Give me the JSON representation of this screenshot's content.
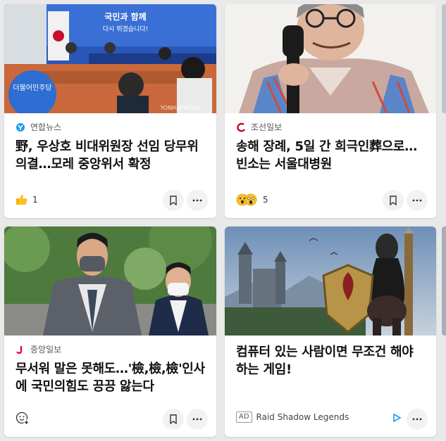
{
  "cards": [
    {
      "source": "연합뉴스",
      "source_icon": "yonhap-logo-icon",
      "headline": "野, 우상호 비대위원장 선임 당무위 의결…모레 중앙위서 확정",
      "reaction_icon": "thumbs-up-icon",
      "reaction_count": "1",
      "image_sign_text": "국민과 함께",
      "image_sign_sub": "다시 뛰겠습니다!",
      "image_logo_text": "더불어민주당",
      "image_watermark": "YONHAPNEWS"
    },
    {
      "source": "조선일보",
      "source_icon": "chosun-logo-icon",
      "headline": "송해 장례, 5일 간 희극인葬으로…빈소는 서울대병원",
      "reaction_icon": "surprised-sad-emoji-icon",
      "reaction_count": "5"
    },
    {
      "source": "중앙일보",
      "source_icon": "joongang-logo-icon",
      "headline": "무서워 말은 못해도…'檢,檢,檢'인사에 국민의힘도 끙끙 앓는다",
      "reaction_icon": "add-reaction-icon",
      "reaction_count": ""
    },
    {
      "ad_badge": "AD",
      "source": "Raid Shadow Legends",
      "headline": "컴퓨터 있는 사람이면 무조건 해야 하는 게임!",
      "ad_icon": "play-triangle-icon"
    }
  ],
  "colors": {
    "page_bg": "#e9e9e9",
    "card_bg": "#ffffff",
    "headline": "#111111",
    "accent_blue": "#1d9bf0"
  }
}
